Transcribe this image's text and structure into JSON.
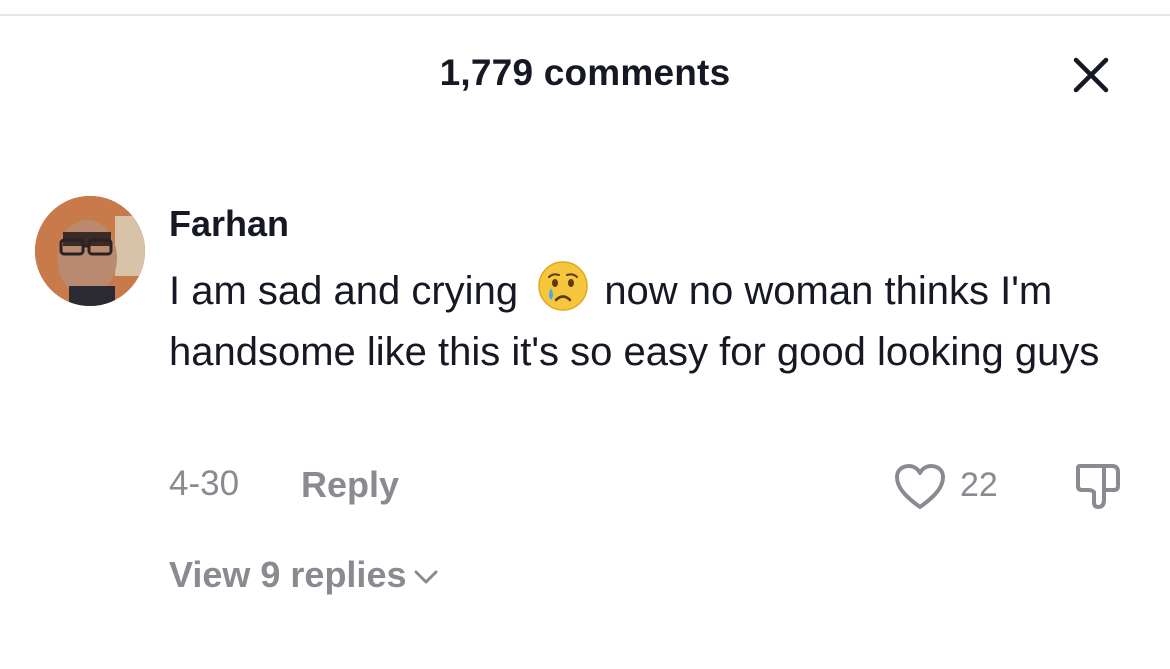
{
  "header": {
    "title": "1,779 comments",
    "close_icon": "close-icon"
  },
  "comment": {
    "username": "Farhan",
    "text_before_emoji": "I am sad and crying",
    "emoji": "crying-face-emoji",
    "text_after_emoji": "now no woman thinks I'm handsome like this it's so easy for good looking guys",
    "date": "4-30",
    "reply_label": "Reply",
    "like_count": "22",
    "view_replies_label": "View 9 replies"
  },
  "colors": {
    "text_primary": "#161823",
    "text_secondary": "#8a8b91",
    "divider": "#e6e6e6"
  }
}
